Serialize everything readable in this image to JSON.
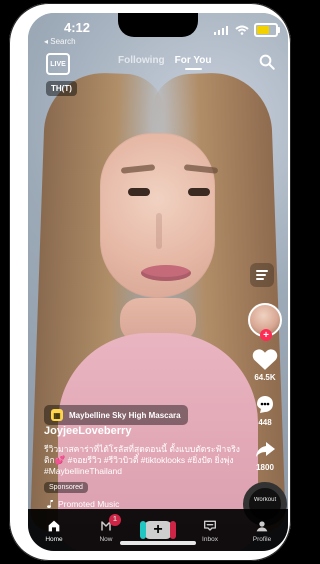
{
  "status": {
    "time": "4:12",
    "back_label": "◂ Search"
  },
  "top_nav": {
    "live_label": "LIVE",
    "tabs": [
      {
        "label": "Following"
      },
      {
        "label": "For You"
      }
    ]
  },
  "video": {
    "language_badge": "TH(T)"
  },
  "ad": {
    "title": "Maybelline Sky High Mascara"
  },
  "post": {
    "username": "JoyjeeLoveberry",
    "caption": "รีวิวมาสคาร่าที่ได้โรลัสที่สุดตอนนี้ ตั้งแบบตัดระฟ้าจริง ติก💕 #จอยรีวิว #รีวิวบิวตี้ #tiktoklooks #ยิ่งปัด ยิ่งพุ่ง #MaybellineThailand",
    "sponsored_label": "Sponsored",
    "music_label": "Promoted Music"
  },
  "actions": {
    "likes": "64.5K",
    "comments": "448",
    "shares": "1800",
    "record_label": "Workout"
  },
  "bottom_nav": {
    "home": "Home",
    "now": "Now",
    "inbox": "Inbox",
    "profile": "Profile",
    "now_badge": "1"
  },
  "colors": {
    "tiktok_red": "#fe2c55",
    "tiktok_cyan": "#25f4ee",
    "battery_yellow": "#f3d000"
  },
  "icons": {
    "search": "search-icon",
    "heart": "heart-icon",
    "comment": "comment-icon",
    "share": "share-icon",
    "music": "music-note-icon",
    "home": "home-icon",
    "inbox": "inbox-icon",
    "profile": "profile-icon"
  }
}
